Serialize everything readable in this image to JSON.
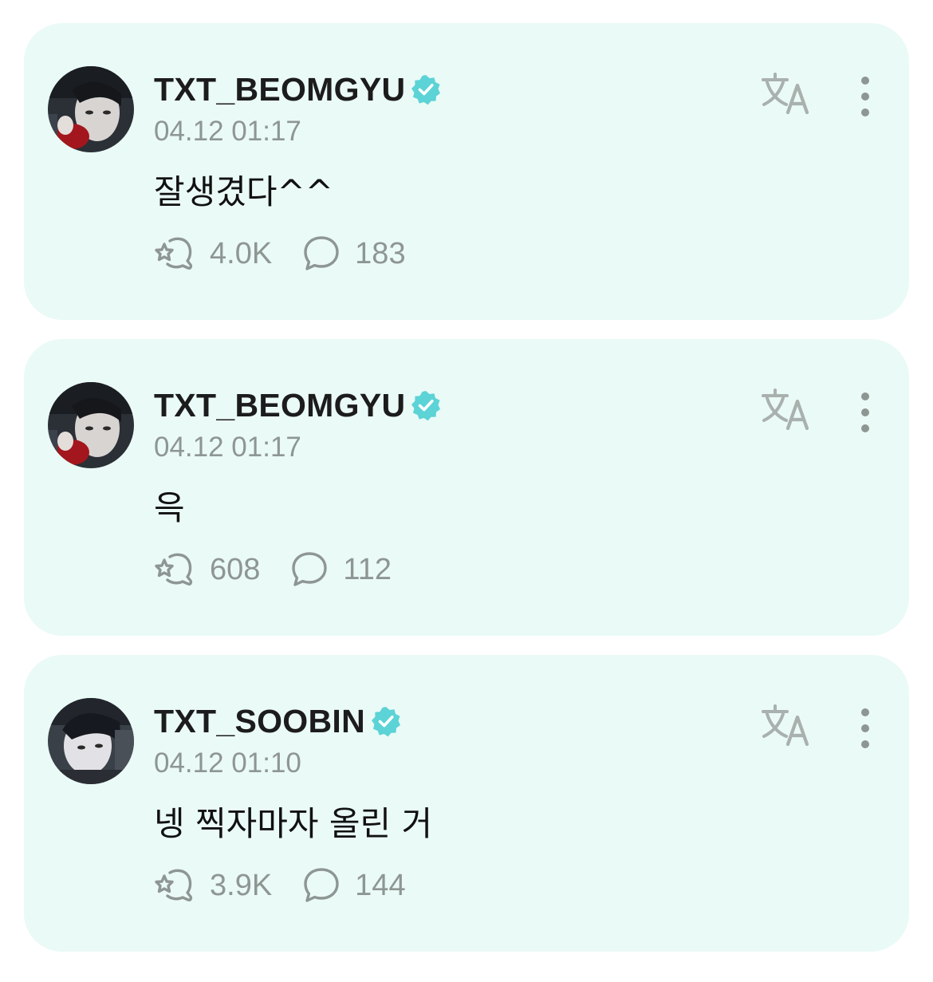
{
  "colors": {
    "card_background": "#eafaf6",
    "verified_badge": "#5cd3d6",
    "muted_text": "#8e9693",
    "primary_text": "#1c1c1c"
  },
  "icons": {
    "verified": "verified-badge-icon",
    "translate": "translate-icon",
    "more": "more-vertical-icon",
    "like": "star-hand-icon",
    "comment": "speech-bubble-icon"
  },
  "posts": [
    {
      "author": "TXT_BEOMGYU",
      "verified": true,
      "timestamp": "04.12 01:17",
      "text": "잘생겼다^^",
      "likes": "4.0K",
      "comments": "183"
    },
    {
      "author": "TXT_BEOMGYU",
      "verified": true,
      "timestamp": "04.12 01:17",
      "text": "윽",
      "likes": "608",
      "comments": "112"
    },
    {
      "author": "TXT_SOOBIN",
      "verified": true,
      "timestamp": "04.12 01:10",
      "text": "넹 찍자마자 올린 거",
      "likes": "3.9K",
      "comments": "144"
    }
  ]
}
